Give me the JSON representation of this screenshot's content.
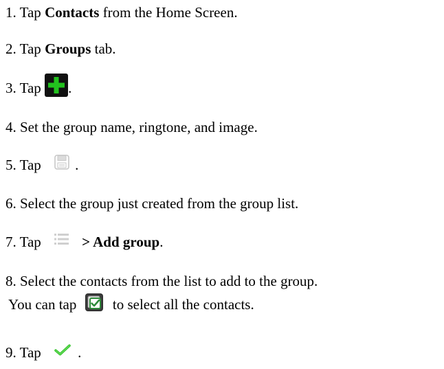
{
  "steps": [
    {
      "num": "1.",
      "pre": "Tap ",
      "bold": "Contacts",
      "post": " from the Home Screen."
    },
    {
      "num": "2.",
      "pre": "Tap ",
      "bold": "Groups",
      "post": " tab."
    },
    {
      "num": "3.",
      "pre": "Tap ",
      "icon": "add-icon",
      "post": "."
    },
    {
      "num": "4.",
      "text": "Set the group name, ringtone, and image."
    },
    {
      "num": "5.",
      "pre": "Tap ",
      "icon": "save-icon",
      "post": "."
    },
    {
      "num": "6.",
      "text": "Select the group just created from the group list."
    },
    {
      "num": "7.",
      "pre": "Tap ",
      "icon": "menu-icon",
      "bold": "> Add group",
      "post": "."
    },
    {
      "num": "8.",
      "text": "Select the contacts from the list to add to the group.",
      "sub_pre": "You can tap ",
      "sub_icon": "select-all-icon",
      "sub_post": " to select all the contacts."
    },
    {
      "num": "9.",
      "pre": "Tap ",
      "icon": "checkmark-icon",
      "post": "."
    }
  ],
  "colors": {
    "add_icon": "#22c21e",
    "checkmark_icon": "#38c42f",
    "select_all_icon": "#2e8b3a"
  }
}
